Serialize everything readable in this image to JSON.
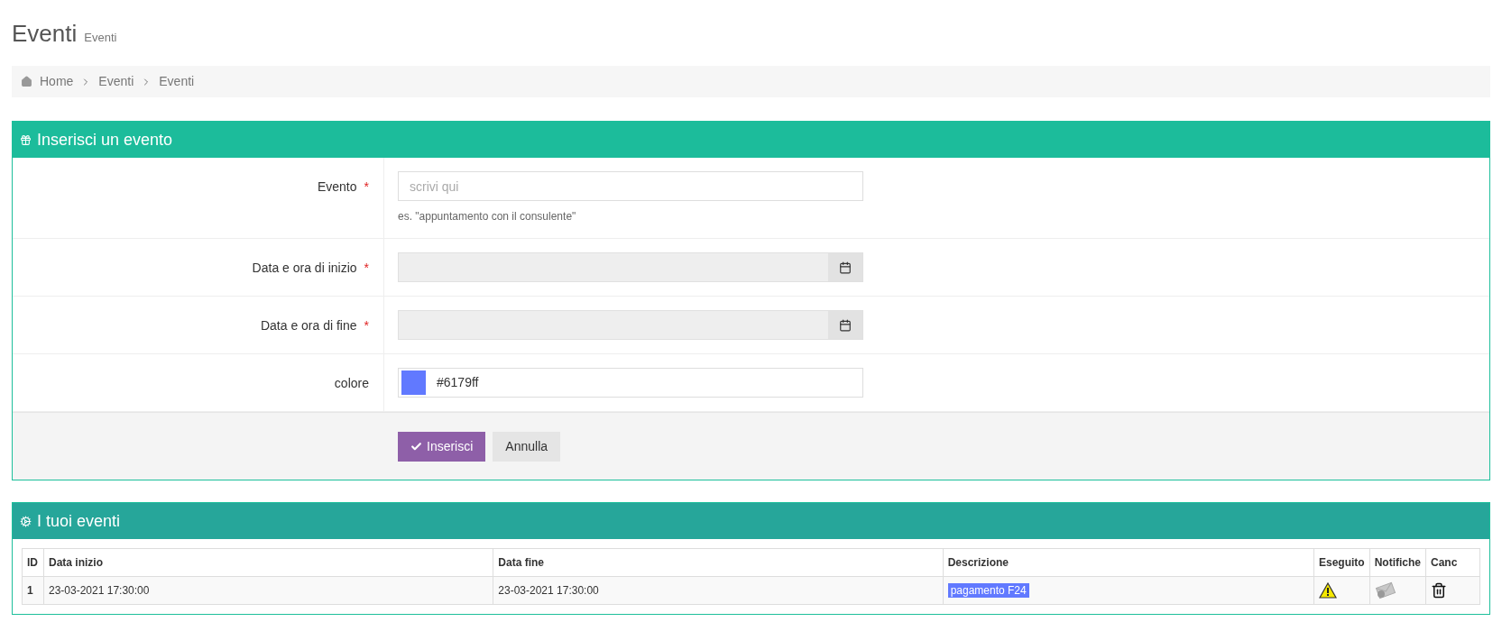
{
  "page_title": "Eventi",
  "page_subtitle": "Eventi",
  "breadcrumb": [
    "Home",
    "Eventi",
    "Eventi"
  ],
  "form_panel": {
    "title": "Inserisci un evento",
    "fields": [
      {
        "kind": "text",
        "label": "Evento",
        "required_mark": "*",
        "placeholder": "scrivi qui",
        "help": "es. \"appuntamento con il consulente\""
      },
      {
        "kind": "datetime",
        "label": "Data e ora di inizio",
        "required_mark": "*"
      },
      {
        "kind": "datetime",
        "label": "Data e ora di fine",
        "required_mark": "*"
      },
      {
        "kind": "color",
        "label": "colore",
        "value": "#6179ff",
        "color": "#6179ff"
      }
    ],
    "buttons": [
      {
        "kind": "primary",
        "label": "Inserisci"
      },
      {
        "kind": "secondary",
        "label": "Annulla"
      }
    ]
  },
  "events_panel": {
    "title": "I tuoi eventi",
    "columns": [
      "ID",
      "Data inizio",
      "Data fine",
      "Descrizione",
      "Eseguito",
      "Notifiche",
      "Canc"
    ],
    "rows": [
      {
        "id": "1",
        "start": "23-03-2021 17:30:00",
        "end": "23-03-2021 17:30:00",
        "description": "pagamento F24",
        "color": "#6179ff"
      }
    ]
  }
}
